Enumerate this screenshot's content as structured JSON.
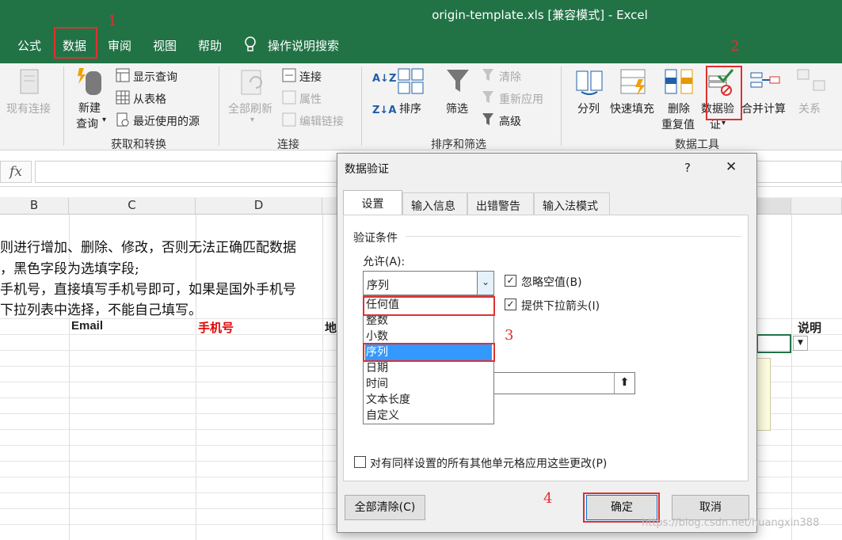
{
  "window": {
    "title": "origin-template.xls  [兼容模式]  -  Excel"
  },
  "ribbon_tabs": [
    "公式",
    "数据",
    "审阅",
    "视图",
    "帮助",
    "操作说明搜索"
  ],
  "ribbon": {
    "existing_connections": "现有连接",
    "new_query": "新建",
    "new_query2": "查询",
    "show_query": "显示查询",
    "from_table": "从表格",
    "recent_sources": "最近使用的源",
    "group_get": "获取和转换",
    "refresh_all": "全部刷新",
    "connections": "连接",
    "properties": "属性",
    "edit_links": "编辑链接",
    "group_conn": "连接",
    "sort": "排序",
    "filter": "筛选",
    "clear": "清除",
    "reapply": "重新应用",
    "advanced": "高级",
    "group_sort": "排序和筛选",
    "text_to_columns": "分列",
    "flash_fill": "快速填充",
    "remove_dup": "删除",
    "remove_dup2": "重复值",
    "data_validation": "数据验",
    "data_validation2": "证",
    "consolidate": "合并计算",
    "relationships": "关系",
    "group_tools": "数据工具"
  },
  "annotations": [
    "1",
    "2",
    "3",
    "4"
  ],
  "formula": {
    "fx": "fx"
  },
  "columns": [
    "B",
    "C",
    "D"
  ],
  "sheet": {
    "line1": "则进行增加、删除、修改，否则无法正确匹配数据",
    "line2": "，黑色字段为选填字段;",
    "line3": "手机号，直接填写手机号即可，如果是国外手机号",
    "line4": "下拉列表中选择，不能自己填写。",
    "h_email": "Email",
    "h_phone": "手机号",
    "h_addr": "地",
    "h_note": "说明"
  },
  "dialog": {
    "title": "数据验证",
    "help": "?",
    "close": "✕",
    "tabs": [
      "设置",
      "输入信息",
      "出错警告",
      "输入法模式"
    ],
    "section": "验证条件",
    "allow_label": "允许(A):",
    "allow_value": "序列",
    "ignore_blank": "忽略空值(B)",
    "dropdown_arrow": "提供下拉箭头(I)",
    "list_items": [
      "任何值",
      "整数",
      "小数",
      "序列",
      "日期",
      "时间",
      "文本长度",
      "自定义"
    ],
    "apply_all": "对有同样设置的所有其他单元格应用这些更改(P)",
    "clear_all": "全部清除(C)",
    "ok": "确定",
    "cancel": "取消"
  },
  "watermark": "https://blog.csdn.net/huangxin388",
  "colors": {
    "excel_green": "#217346",
    "highlight": "#3399ff",
    "annotation": "#e03030"
  }
}
